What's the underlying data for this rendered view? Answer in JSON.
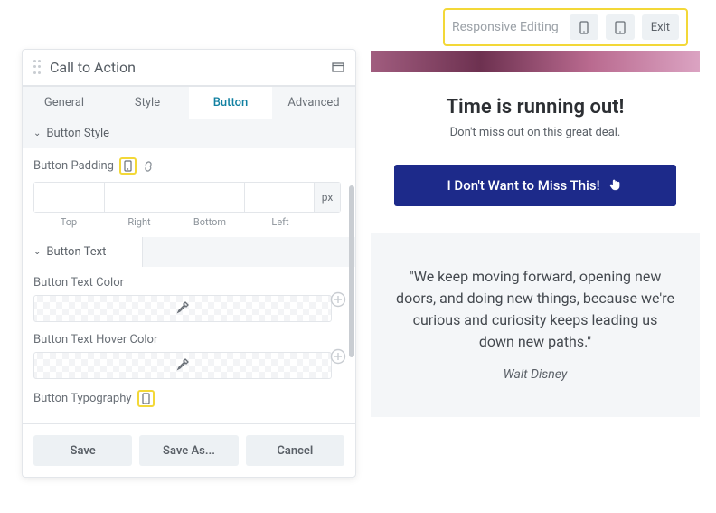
{
  "toolbar": {
    "label": "Responsive Editing",
    "exit": "Exit"
  },
  "panel": {
    "title": "Call to Action",
    "tabs": [
      "General",
      "Style",
      "Button",
      "Advanced"
    ],
    "active_tab": 2
  },
  "sections": {
    "button_style": {
      "title": "Button Style",
      "padding_label": "Button Padding",
      "unit": "px",
      "sides": [
        "Top",
        "Right",
        "Bottom",
        "Left"
      ]
    },
    "button_text": {
      "title": "Button Text",
      "text_color_label": "Button Text Color",
      "hover_color_label": "Button Text Hover Color",
      "typography_label": "Button Typography"
    }
  },
  "footer": {
    "save": "Save",
    "save_as": "Save As...",
    "cancel": "Cancel"
  },
  "preview": {
    "title": "Time is running out!",
    "subtitle": "Don't miss out on this great deal.",
    "cta": "I Don't Want to Miss This!",
    "quote": "\"We keep moving forward, opening new doors, and doing new things, because we're curious and curiosity keeps leading us down new paths.\"",
    "author": "Walt Disney"
  }
}
